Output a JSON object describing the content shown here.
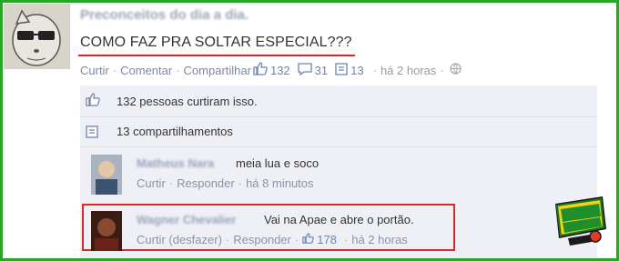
{
  "post": {
    "author": "Preconceitos do dia a dia.",
    "text": "COMO FAZ PRA SOLTAR ESPECIAL???",
    "actions": {
      "like": "Curtir",
      "comment": "Comentar",
      "share": "Compartilhar",
      "likes_count": "132",
      "comments_count": "31",
      "shares_count": "13",
      "time": "há 2 horas"
    }
  },
  "summary": {
    "likes_text": "132 pessoas curtiram isso.",
    "shares_text": "13 compartilhamentos"
  },
  "comments": [
    {
      "author": "Matheus Nara",
      "text": "meia lua e soco",
      "like": "Curtir",
      "reply": "Responder",
      "time": "há 8 minutos"
    },
    {
      "author": "Wagner Chevalier",
      "text": "Vai na Apae e abre o portão.",
      "like": "Curtir (desfazer)",
      "reply": "Responder",
      "likes": "178",
      "time": "há 2 horas"
    }
  ],
  "colors": {
    "frame": "#2aa52a",
    "highlight": "#d92a2a",
    "link": "#6d84b4",
    "panel": "#eef0f6"
  }
}
